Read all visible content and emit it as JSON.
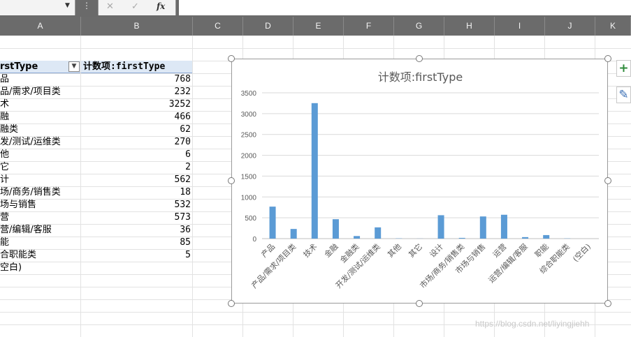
{
  "formula_bar": {
    "cancel_icon": "✕",
    "enter_icon": "✓",
    "fx_label": "fx",
    "formula_value": ""
  },
  "columns": [
    "A",
    "B",
    "C",
    "D",
    "E",
    "F",
    "G",
    "H",
    "I",
    "J",
    "K"
  ],
  "pivot": {
    "header_a": "rstType",
    "header_b": "计数项:firstType",
    "rows": [
      {
        "label": "品",
        "count": "768"
      },
      {
        "label": "品/需求/项目类",
        "count": "232"
      },
      {
        "label": "术",
        "count": "3252"
      },
      {
        "label": "融",
        "count": "466"
      },
      {
        "label": "融类",
        "count": "62"
      },
      {
        "label": "发/测试/运维类",
        "count": "270"
      },
      {
        "label": "他",
        "count": "6"
      },
      {
        "label": "它",
        "count": "2"
      },
      {
        "label": "计",
        "count": "562"
      },
      {
        "label": "场/商务/销售类",
        "count": "18"
      },
      {
        "label": "场与销售",
        "count": "532"
      },
      {
        "label": "营",
        "count": "573"
      },
      {
        "label": "营/编辑/客服",
        "count": "36"
      },
      {
        "label": "能",
        "count": "85"
      },
      {
        "label": "合职能类",
        "count": "5"
      },
      {
        "label": "空白)",
        "count": ""
      }
    ]
  },
  "chart_data": {
    "type": "bar",
    "title": "计数项:firstType",
    "categories": [
      "产品",
      "产品/需求/项目类",
      "技术",
      "金融",
      "金融类",
      "开发/测试/运维类",
      "其他",
      "其它",
      "设计",
      "市场/商务/销售类",
      "市场与销售",
      "运营",
      "运营/编辑/客服",
      "职能",
      "综合职能类",
      "(空白)"
    ],
    "values": [
      768,
      232,
      3252,
      466,
      62,
      270,
      6,
      2,
      562,
      18,
      532,
      573,
      36,
      85,
      5,
      0
    ],
    "yticks": [
      "0",
      "500",
      "1000",
      "1500",
      "2000",
      "2500",
      "3000",
      "3500"
    ],
    "ylim": [
      0,
      3500
    ],
    "grid": true,
    "bar_color": "#5b9bd5"
  },
  "side_buttons": {
    "add_icon": "+",
    "brush_icon": "✎"
  },
  "watermark": "https://blog.csdn.net/liyingjiehh"
}
